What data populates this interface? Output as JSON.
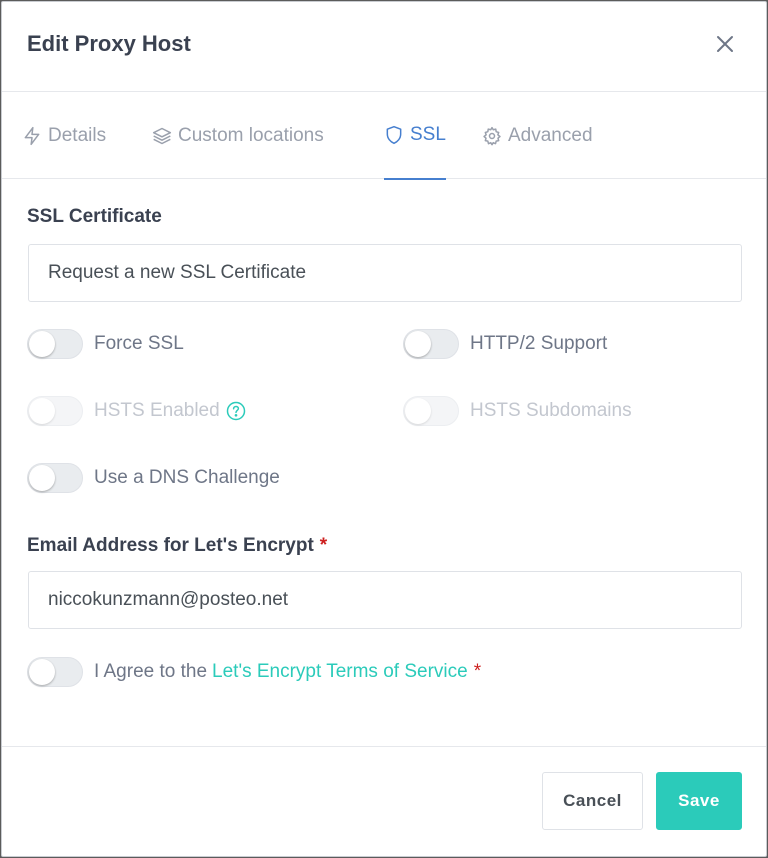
{
  "modal": {
    "title": "Edit Proxy Host"
  },
  "tabs": [
    {
      "label": "Details",
      "icon": "bolt-icon",
      "active": false
    },
    {
      "label": "Custom locations",
      "icon": "layers-icon",
      "active": false
    },
    {
      "label": "SSL",
      "icon": "shield-icon",
      "active": true
    },
    {
      "label": "Advanced",
      "icon": "gear-icon",
      "active": false
    }
  ],
  "ssl": {
    "certificate_label": "SSL Certificate",
    "certificate_value": "Request a new SSL Certificate",
    "force_ssl": {
      "label": "Force SSL",
      "on": false,
      "disabled": false
    },
    "http2": {
      "label": "HTTP/2 Support",
      "on": false,
      "disabled": false
    },
    "hsts": {
      "label": "HSTS Enabled",
      "on": false,
      "disabled": true
    },
    "hsts_subdomains": {
      "label": "HSTS Subdomains",
      "on": false,
      "disabled": true
    },
    "dns_challenge": {
      "label": "Use a DNS Challenge",
      "on": false,
      "disabled": false
    },
    "email_label": "Email Address for Let's Encrypt",
    "required_mark": "*",
    "email_value": "niccokunzmann@posteo.net",
    "agree_prefix": "I Agree to the",
    "agree_link": "Let's Encrypt Terms of Service",
    "agree_on": false
  },
  "footer": {
    "cancel_label": "Cancel",
    "save_label": "Save"
  },
  "colors": {
    "accent": "#467fcf",
    "teal": "#2bcbba",
    "required": "#cd201f"
  }
}
